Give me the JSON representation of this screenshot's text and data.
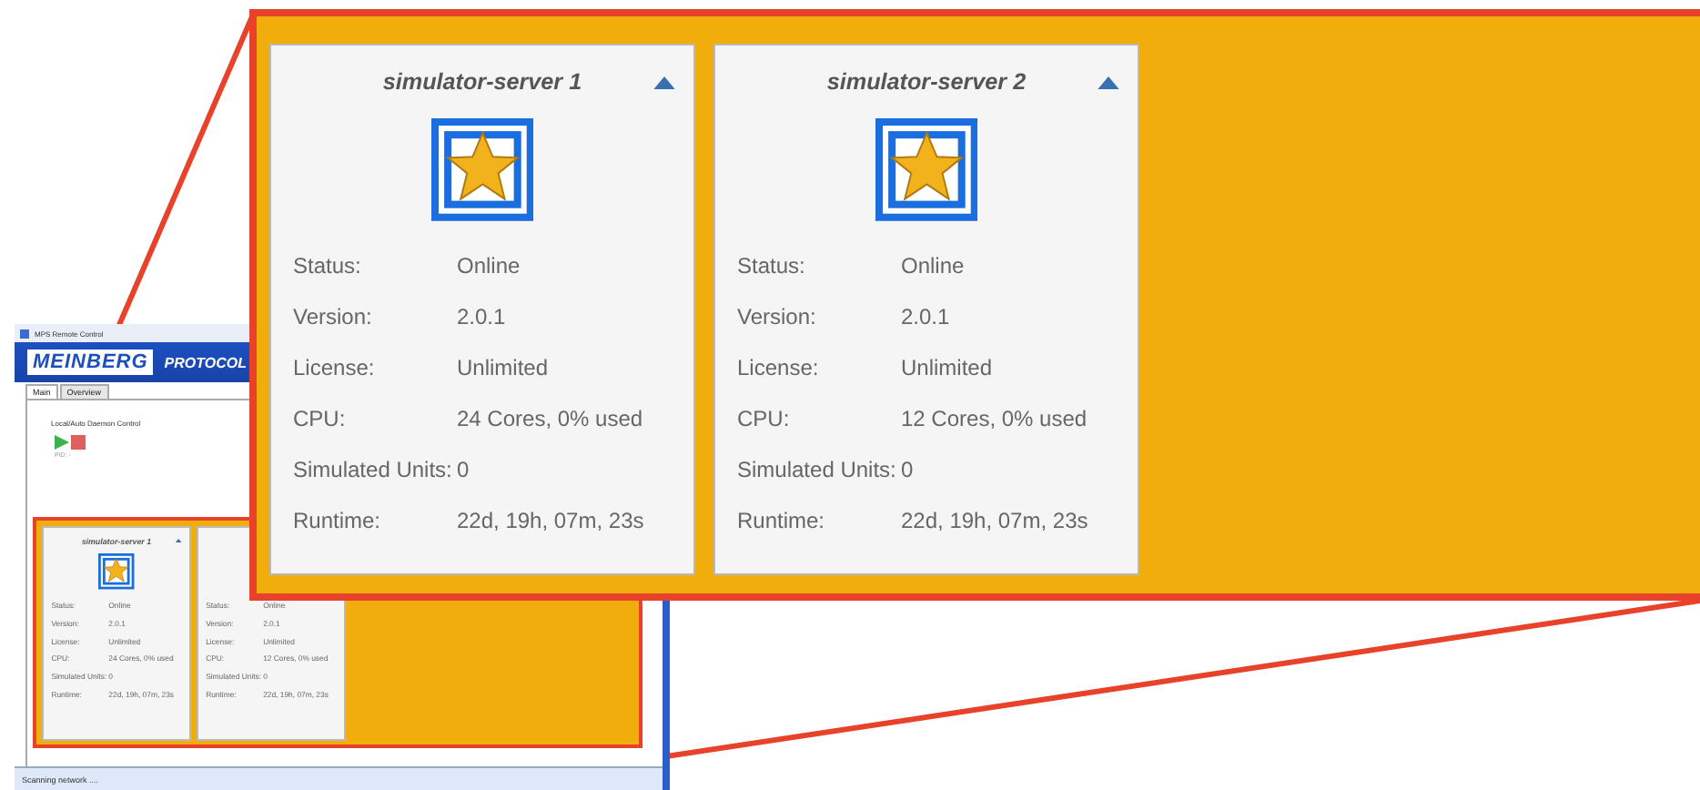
{
  "window": {
    "title": "MPS Remote Control",
    "logo": "MEINBERG",
    "product": "PROTOCOL",
    "tabs": [
      {
        "label": "Main",
        "selected": true
      },
      {
        "label": "Overview",
        "selected": false
      }
    ],
    "section_label": "Local/Auto Daemon Control",
    "pid": "PID: -",
    "cards": [
      {
        "title": "simulator-server 1",
        "fields": [
          {
            "label": "Status:",
            "value": "Online"
          },
          {
            "label": "Version:",
            "value": "2.0.1"
          },
          {
            "label": "License:",
            "value": "Unlimited"
          },
          {
            "label": "CPU:",
            "value": "24 Cores, 0% used"
          },
          {
            "label": "Simulated Units:",
            "value": "0"
          },
          {
            "label": "Runtime:",
            "value": "22d, 19h, 07m, 23s"
          }
        ]
      },
      {
        "fields": [
          {
            "label": "Status:",
            "value": "Online"
          },
          {
            "label": "Version:",
            "value": "2.0.1"
          },
          {
            "label": "License:",
            "value": "Unlimited"
          },
          {
            "label": "CPU:",
            "value": "12 Cores, 0% used"
          },
          {
            "label": "Simulated Units:",
            "value": "0"
          },
          {
            "label": "Runtime:",
            "value": "22d, 19h, 07m, 23s"
          }
        ]
      }
    ],
    "status_bar": "Scanning network ...."
  },
  "callout": {
    "cards": [
      {
        "title": "simulator-server 1",
        "fields": [
          {
            "label": "Status:",
            "value": "Online"
          },
          {
            "label": "Version:",
            "value": "2.0.1"
          },
          {
            "label": "License:",
            "value": "Unlimited"
          },
          {
            "label": "CPU:",
            "value": "24 Cores, 0% used"
          },
          {
            "label": "Simulated Units:",
            "value": "0"
          },
          {
            "label": "Runtime:",
            "value": "22d, 19h, 07m, 23s"
          }
        ]
      },
      {
        "title": "simulator-server 2",
        "fields": [
          {
            "label": "Status:",
            "value": "Online"
          },
          {
            "label": "Version:",
            "value": "2.0.1"
          },
          {
            "label": "License:",
            "value": "Unlimited"
          },
          {
            "label": "CPU:",
            "value": "12 Cores, 0% used"
          },
          {
            "label": "Simulated Units:",
            "value": "0"
          },
          {
            "label": "Runtime:",
            "value": "22d, 19h, 07m, 23s"
          }
        ]
      }
    ]
  }
}
